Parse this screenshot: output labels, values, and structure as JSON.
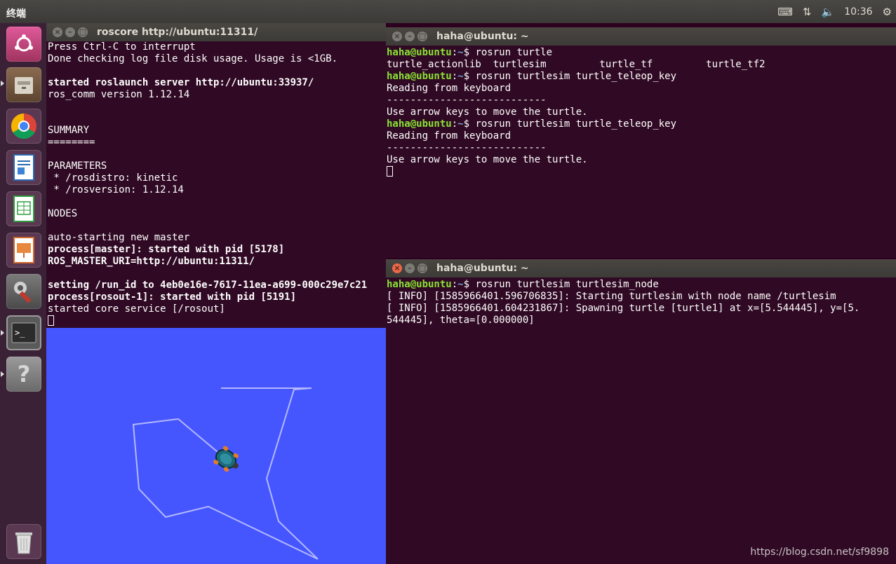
{
  "panel": {
    "title": "终端",
    "time": "10:36",
    "icons": [
      "keyboard-icon",
      "network-icon",
      "volume-icon",
      "gear-icon"
    ]
  },
  "launcher": {
    "items": [
      "ubuntu-logo-icon",
      "files-icon",
      "chrome-icon",
      "writer-icon",
      "calc-icon",
      "impress-icon",
      "system-settings-icon",
      "terminal-icon",
      "help-icon",
      "trash-icon"
    ]
  },
  "roscore": {
    "title": "roscore http://ubuntu:11311/",
    "lines": [
      {
        "text": "Press Ctrl-C to interrupt",
        "bold": false
      },
      {
        "text": "Done checking log file disk usage. Usage is <1GB.",
        "bold": false
      },
      {
        "text": "",
        "bold": false
      },
      {
        "text": "started roslaunch server http://ubuntu:33937/",
        "bold": true
      },
      {
        "text": "ros_comm version 1.12.14",
        "bold": false
      },
      {
        "text": "",
        "bold": false
      },
      {
        "text": "",
        "bold": false
      },
      {
        "text": "SUMMARY",
        "bold": false
      },
      {
        "text": "========",
        "bold": false
      },
      {
        "text": "",
        "bold": false
      },
      {
        "text": "PARAMETERS",
        "bold": false
      },
      {
        "text": " * /rosdistro: kinetic",
        "bold": false
      },
      {
        "text": " * /rosversion: 1.12.14",
        "bold": false
      },
      {
        "text": "",
        "bold": false
      },
      {
        "text": "NODES",
        "bold": false
      },
      {
        "text": "",
        "bold": false
      },
      {
        "text": "auto-starting new master",
        "bold": false
      },
      {
        "text": "process[master]: started with pid [5178]",
        "bold": true
      },
      {
        "text": "ROS_MASTER_URI=http://ubuntu:11311/",
        "bold": true
      },
      {
        "text": "",
        "bold": false
      },
      {
        "text": "setting /run_id to 4eb0e16e-7617-11ea-a699-000c29e7c21",
        "bold": true
      },
      {
        "text": "process[rosout-1]: started with pid [5191]",
        "bold": true
      },
      {
        "text": "started core service [/rosout]",
        "bold": false
      }
    ]
  },
  "teleop": {
    "title": "haha@ubuntu: ~",
    "prompt_user": "haha@ubuntu",
    "prompt_path": ":~$ ",
    "lines": [
      {
        "type": "cmd",
        "text": "rosrun turtle"
      },
      {
        "type": "out",
        "text": "turtle_actionlib  turtlesim         turtle_tf         turtle_tf2"
      },
      {
        "type": "cmd",
        "text": "rosrun turtlesim turtle_teleop_key"
      },
      {
        "type": "out",
        "text": "Reading from keyboard"
      },
      {
        "type": "out",
        "text": "---------------------------"
      },
      {
        "type": "out",
        "text": "Use arrow keys to move the turtle."
      },
      {
        "type": "cmd",
        "text": "rosrun turtlesim turtle_teleop_key"
      },
      {
        "type": "out",
        "text": "Reading from keyboard"
      },
      {
        "type": "out",
        "text": "---------------------------"
      },
      {
        "type": "out",
        "text": "Use arrow keys to move the turtle."
      }
    ]
  },
  "turtlesim_node": {
    "title": "haha@ubuntu: ~",
    "lines": [
      {
        "type": "cmd",
        "text": "rosrun turtlesim turtlesim_node"
      },
      {
        "type": "out",
        "text": "[ INFO] [1585966401.596706835]: Starting turtlesim with node name /turtlesim"
      },
      {
        "type": "out",
        "text": "[ INFO] [1585966401.604231867]: Spawning turtle [turtle1] at x=[5.544445], y=[5."
      },
      {
        "type": "out",
        "text": "544445], theta=[0.000000]"
      }
    ]
  },
  "watermark": "https://blog.csdn.net/sf9898",
  "colors": {
    "terminal_bg": "#300a24",
    "turtlesim_bg": "#4556ff",
    "prompt_green": "#8ae234",
    "prompt_blue": "#729fcf"
  }
}
